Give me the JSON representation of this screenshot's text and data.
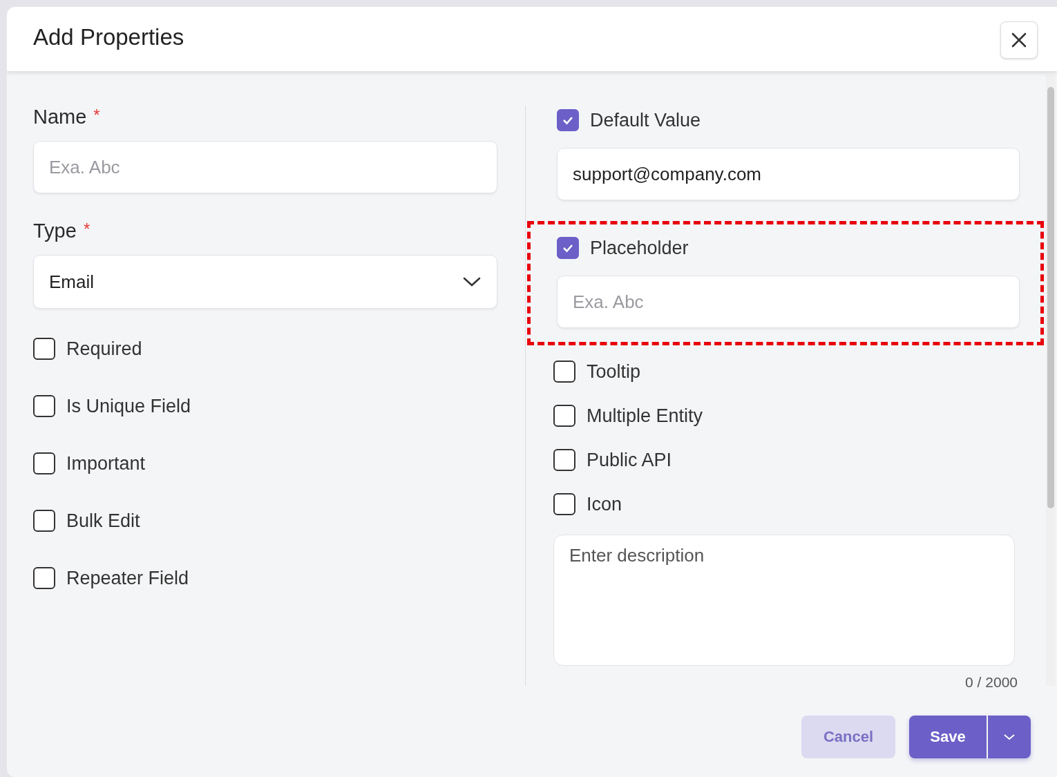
{
  "dialog": {
    "title": "Add Properties"
  },
  "left": {
    "fields": [
      {
        "kind": "text",
        "label": "Name",
        "asterisk": "*",
        "placeholder": "Exa. Abc"
      },
      {
        "kind": "select",
        "label": "Type",
        "asterisk": "*",
        "value": "Email"
      }
    ],
    "checkboxes": [
      {
        "label": "Required",
        "checked": false
      },
      {
        "label": "Is Unique Field",
        "checked": false
      },
      {
        "label": "Important",
        "checked": false
      },
      {
        "label": "Bulk Edit",
        "checked": false
      },
      {
        "label": "Repeater Field",
        "checked": false
      }
    ]
  },
  "right": {
    "sections": [
      {
        "label": "Default Value",
        "checked": true,
        "value": "support@company.com"
      },
      {
        "label": "Placeholder",
        "checked": true,
        "placeholder": "Exa. Abc",
        "highlighted": true
      }
    ],
    "checkboxes": [
      {
        "label": "Tooltip",
        "checked": false
      },
      {
        "label": "Multiple Entity",
        "checked": false
      },
      {
        "label": "Public API",
        "checked": false
      },
      {
        "label": "Icon",
        "checked": false
      }
    ],
    "description": {
      "placeholder": "Enter description",
      "counter": "0 / 2000"
    }
  },
  "footer": {
    "buttons": [
      {
        "kind": "secondary",
        "label": "Cancel"
      },
      {
        "kind": "primary",
        "label": "Save"
      }
    ]
  }
}
